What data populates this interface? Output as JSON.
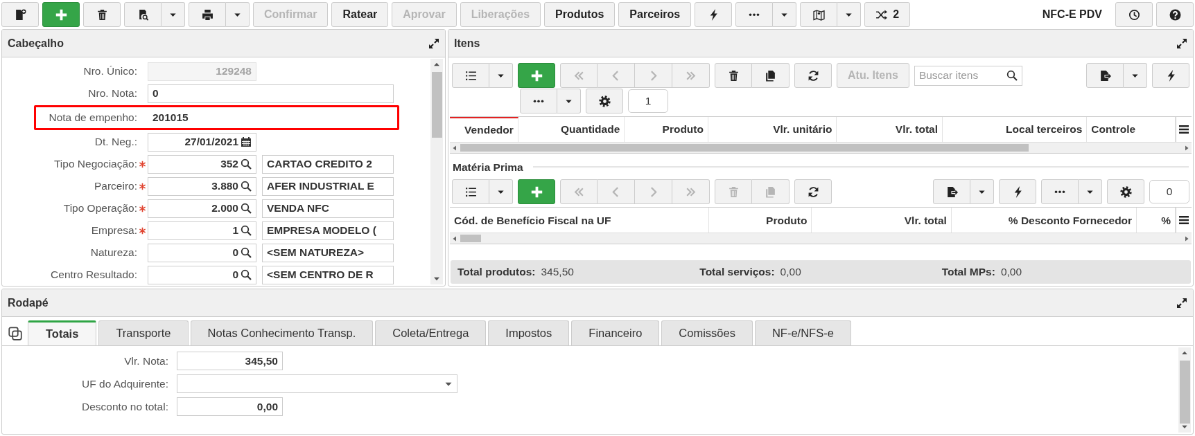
{
  "toolbar": {
    "items": [
      {
        "kind": "icon",
        "disabled": false
      },
      {
        "kind": "primary",
        "disabled": false
      },
      {
        "kind": "icon",
        "disabled": false
      },
      {
        "kind": "split",
        "disabled": false
      },
      {
        "kind": "split",
        "disabled": false
      },
      {
        "kind": "text",
        "label": "Confirmar",
        "disabled": true
      },
      {
        "kind": "text",
        "label": "Ratear",
        "disabled": false
      },
      {
        "kind": "text",
        "label": "Aprovar",
        "disabled": true
      },
      {
        "kind": "text",
        "label": "Liberações",
        "disabled": true
      },
      {
        "kind": "text",
        "label": "Produtos",
        "disabled": false
      },
      {
        "kind": "text",
        "label": "Parceiros",
        "disabled": false
      },
      {
        "kind": "icon",
        "disabled": false
      },
      {
        "kind": "split",
        "disabled": false
      },
      {
        "kind": "split",
        "disabled": false
      },
      {
        "kind": "icon_text",
        "label": "2",
        "disabled": false
      }
    ],
    "title": "NFC-E PDV",
    "right": [
      {
        "kind": "icon",
        "disabled": false
      },
      {
        "kind": "icon",
        "disabled": false
      }
    ]
  },
  "header_panel": {
    "title": "Cabeçalho",
    "fields": [
      {
        "label": "Nro. Único:",
        "kind": "readonly",
        "value": "129248",
        "required": false,
        "highlighted": false
      },
      {
        "label": "Nro. Nota:",
        "kind": "wide",
        "value": "0",
        "required": false,
        "highlighted": false
      },
      {
        "label": "Nota de empenho:",
        "kind": "wide",
        "value": "201015",
        "required": false,
        "highlighted": true
      },
      {
        "label": "Dt. Neg.:",
        "kind": "date",
        "value": "27/01/2021",
        "required": false,
        "highlighted": false
      },
      {
        "label": "Tipo Negociação:",
        "kind": "lookup",
        "value": "352",
        "description": "CARTAO CREDITO 2",
        "required": true,
        "highlighted": false
      },
      {
        "label": "Parceiro:",
        "kind": "lookup",
        "value": "3.880",
        "description": "AFER INDUSTRIAL E",
        "required": true,
        "highlighted": false
      },
      {
        "label": "Tipo Operação:",
        "kind": "lookup",
        "value": "2.000",
        "description": "VENDA NFC",
        "required": true,
        "highlighted": false
      },
      {
        "label": "Empresa:",
        "kind": "lookup",
        "value": "1",
        "description": "EMPRESA MODELO (",
        "required": true,
        "highlighted": false
      },
      {
        "label": "Natureza:",
        "kind": "lookup",
        "value": "0",
        "description": "<SEM NATUREZA>",
        "required": false,
        "highlighted": false
      },
      {
        "label": "Centro Resultado:",
        "kind": "lookup",
        "value": "0",
        "description": "<SEM CENTRO DE R",
        "required": false,
        "highlighted": false
      }
    ]
  },
  "items_panel": {
    "title": "Itens",
    "toolbar": {
      "left": [
        {
          "kind": "split",
          "disabled": false
        },
        {
          "kind": "primary",
          "disabled": false
        },
        {
          "kind": "group",
          "buttons": [
            {
              "disabled": true
            },
            {
              "disabled": true
            },
            {
              "disabled": true
            },
            {
              "disabled": true
            }
          ]
        },
        {
          "kind": "group",
          "buttons": [
            {
              "disabled": false
            },
            {
              "disabled": false
            }
          ]
        },
        {
          "kind": "icon",
          "disabled": false
        },
        {
          "kind": "text",
          "label": "Atu. Itens",
          "disabled": true
        },
        {
          "kind": "search",
          "placeholder": "Buscar itens"
        }
      ],
      "right": [
        {
          "kind": "split",
          "disabled": false
        },
        {
          "kind": "icon",
          "disabled": false
        }
      ],
      "second_row": [
        {
          "kind": "split",
          "disabled": false
        },
        {
          "kind": "icon",
          "disabled": false
        },
        {
          "kind": "page",
          "value": "1"
        }
      ]
    },
    "columns": [
      {
        "label": "Vendedor",
        "selected": true
      },
      {
        "label": "Quantidade",
        "selected": false
      },
      {
        "label": "Produto",
        "selected": false
      },
      {
        "label": "Vlr. unitário",
        "selected": false
      },
      {
        "label": "Vlr. total",
        "selected": false
      },
      {
        "label": "Local terceiros",
        "selected": false
      },
      {
        "label": "Controle",
        "selected": false
      }
    ],
    "materia_prima": {
      "title": "Matéria Prima",
      "toolbar": {
        "left": [
          {
            "kind": "split",
            "disabled": false
          },
          {
            "kind": "primary",
            "disabled": false
          },
          {
            "kind": "group",
            "buttons": [
              {
                "disabled": true
              },
              {
                "disabled": true
              },
              {
                "disabled": true
              },
              {
                "disabled": true
              }
            ]
          },
          {
            "kind": "group",
            "buttons": [
              {
                "disabled": true
              },
              {
                "disabled": true
              }
            ]
          },
          {
            "kind": "icon",
            "disabled": false
          }
        ],
        "right": [
          {
            "kind": "split",
            "disabled": false
          },
          {
            "kind": "icon",
            "disabled": false
          },
          {
            "kind": "split",
            "disabled": false
          },
          {
            "kind": "icon",
            "disabled": false
          },
          {
            "kind": "page",
            "value": "0"
          }
        ]
      },
      "columns": [
        {
          "label": "Cód. de Benefício Fiscal na UF",
          "selected": false
        },
        {
          "label": "Produto",
          "selected": false
        },
        {
          "label": "Vlr. total",
          "selected": false
        },
        {
          "label": "% Desconto Fornecedor",
          "selected": false
        },
        {
          "label": "%",
          "selected": false
        }
      ]
    },
    "totals": [
      {
        "label": "Total produtos:",
        "value": "345,50"
      },
      {
        "label": "Total serviços:",
        "value": "0,00"
      },
      {
        "label": "Total MPs:",
        "value": "0,00"
      }
    ]
  },
  "footer_panel": {
    "title": "Rodapé",
    "tabs": [
      {
        "label": "Totais",
        "selected": true
      },
      {
        "label": "Transporte",
        "selected": false
      },
      {
        "label": "Notas Conhecimento Transp.",
        "selected": false
      },
      {
        "label": "Coleta/Entrega",
        "selected": false
      },
      {
        "label": "Impostos",
        "selected": false
      },
      {
        "label": "Financeiro",
        "selected": false
      },
      {
        "label": "Comissões",
        "selected": false
      },
      {
        "label": "NF-e/NFS-e",
        "selected": false
      }
    ],
    "fields": [
      {
        "label": "Vlr. Nota:",
        "kind": "number",
        "value": "345,50"
      },
      {
        "label": "UF do Adquirente:",
        "kind": "select"
      },
      {
        "label": "Desconto no total:",
        "kind": "number",
        "value": "0,00"
      }
    ]
  }
}
